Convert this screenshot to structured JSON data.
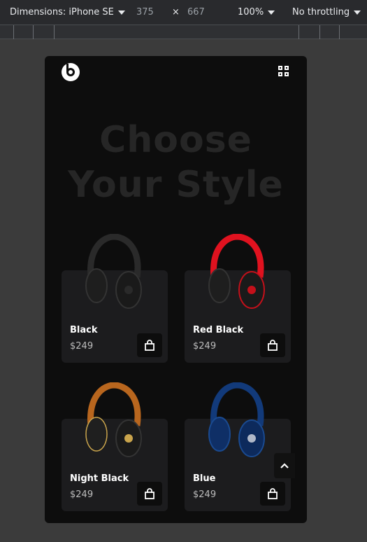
{
  "devtools": {
    "dimensions_label": "Dimensions: iPhone SE",
    "width": "375",
    "times": "×",
    "height": "667",
    "zoom": "100%",
    "throttling": "No throttling"
  },
  "app": {
    "headline_line1": "Choose",
    "headline_line2": "Your Style",
    "products": [
      {
        "name": "Black",
        "price": "$249",
        "band_color": "#2a2a2a",
        "accent_color": "#3a3a3a",
        "cup_color": "#1e1e1e"
      },
      {
        "name": "Red Black",
        "price": "$249",
        "band_color": "#e0121f",
        "accent_color": "#c4101a",
        "cup_color": "#1e1e1e"
      },
      {
        "name": "Night Black",
        "price": "$249",
        "band_color": "#b8661e",
        "accent_color": "#c9a44c",
        "cup_color": "#1f1f1f"
      },
      {
        "name": "Blue",
        "price": "$249",
        "band_color": "#123a7a",
        "accent_color": "#b0b8c8",
        "cup_color": "#0f2f66"
      }
    ]
  },
  "icons": {
    "logo": "beats-logo-icon",
    "menu": "grid-icon",
    "cart": "shopping-bag-icon",
    "scroll": "chevron-up-icon"
  }
}
